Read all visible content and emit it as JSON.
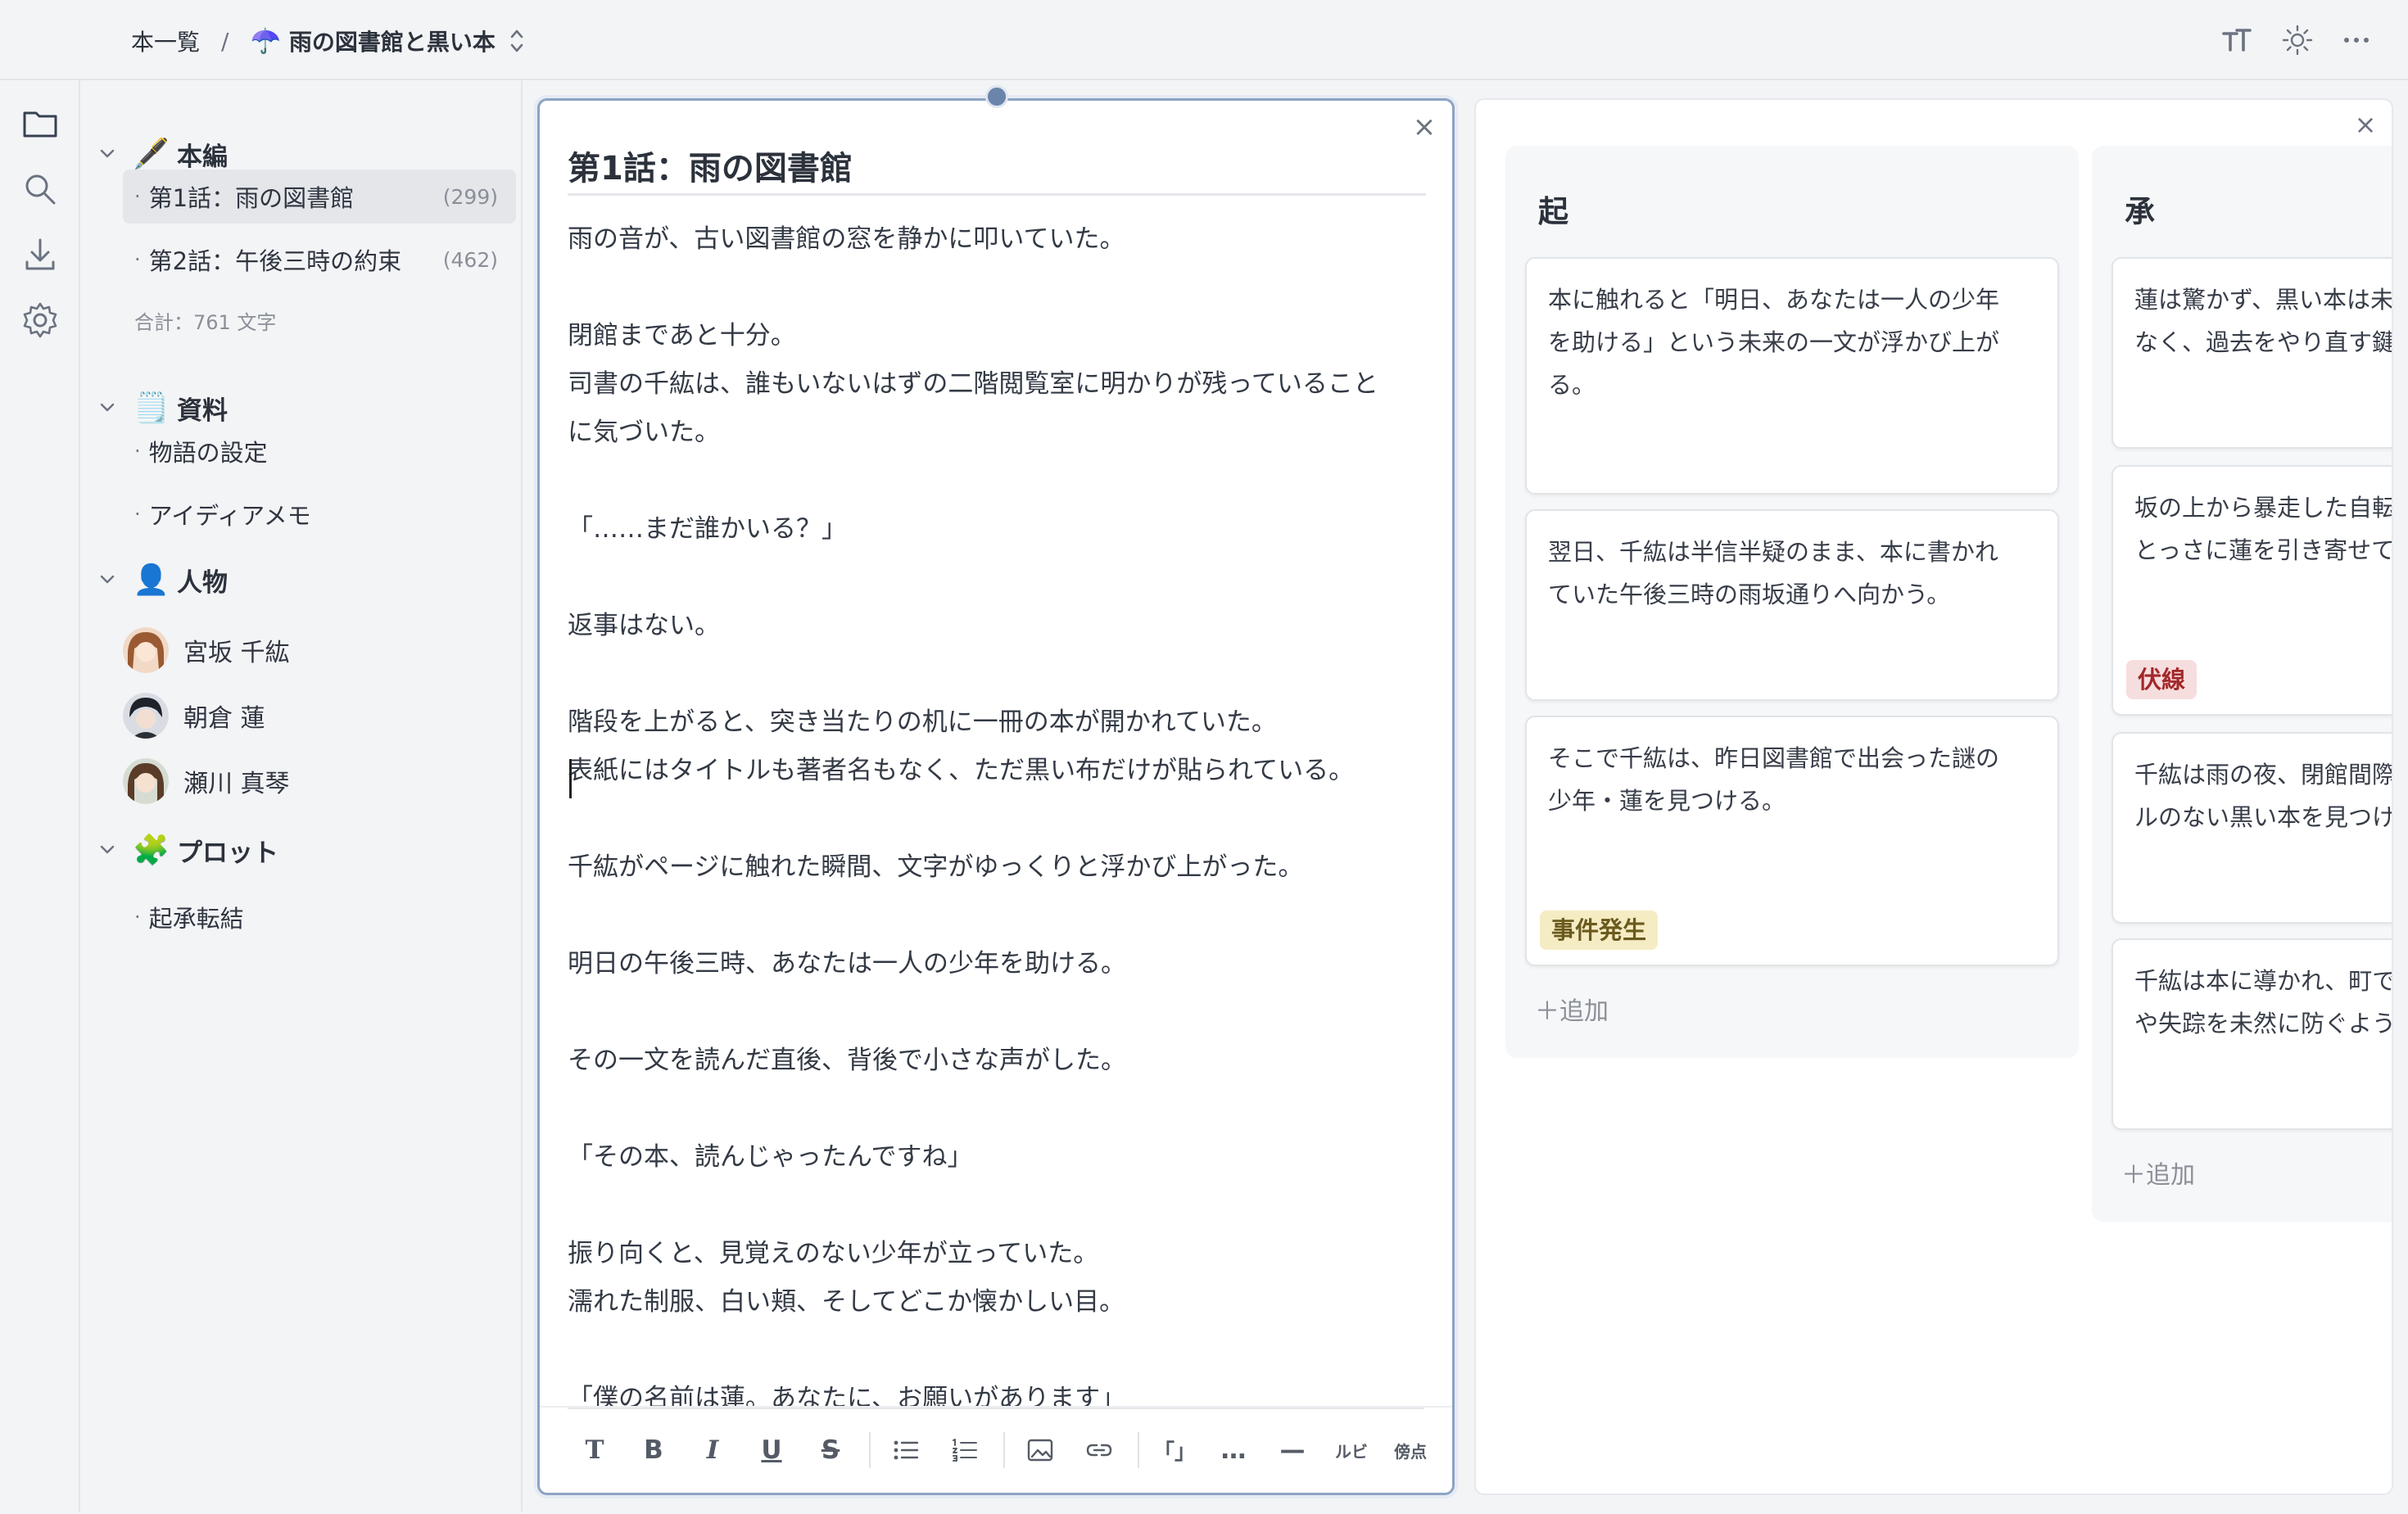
{
  "breadcrumb": {
    "root": "本一覧",
    "separator": "/",
    "book_emoji": "☂️",
    "book_title": "雨の図書館と黒い本"
  },
  "sidebar": {
    "sections": [
      {
        "emoji": "🖋️",
        "label": "本編"
      },
      {
        "emoji": "🗒️",
        "label": "資料"
      },
      {
        "emoji": "👤",
        "label": "人物"
      },
      {
        "emoji": "🧩",
        "label": "プロット"
      }
    ],
    "chapters": [
      {
        "label": "第1話：雨の図書館",
        "count": "(299)"
      },
      {
        "label": "第2話：午後三時の約束",
        "count": "(462)"
      }
    ],
    "total": "合計：761 文字",
    "materials": [
      "物語の設定",
      "アイディアメモ"
    ],
    "characters": [
      "宮坂 千紘",
      "朝倉 蓮",
      "瀬川 真琴"
    ],
    "plots": [
      "起承転結"
    ]
  },
  "editor": {
    "title": "第1話：雨の図書館",
    "body": "雨の音が、古い図書館の窓を静かに叩いていた。\n\n閉館まであと十分。\n司書の千紘は、誰もいないはずの二階閲覧室に明かりが残っていること\nに気づいた。\n\n「……まだ誰かいる？」\n\n返事はない。\n\n階段を上がると、突き当たりの机に一冊の本が開かれていた。\n表紙にはタイトルも著者名もなく、ただ黒い布だけが貼られている。\n\n千紘がページに触れた瞬間、文字がゆっくりと浮かび上がった。\n\n明日の午後三時、あなたは一人の少年を助ける。\n\nその一文を読んだ直後、背後で小さな声がした。\n\n「その本、読んじゃったんですね」\n\n振り向くと、見覚えのない少年が立っていた。\n濡れた制服、白い頬、そしてどこか懐かしい目。\n\n「僕の名前は蓮。あなたに、お願いがあります」",
    "toolbar": [
      "T",
      "B",
      "I",
      "U",
      "S",
      "bulleted-list",
      "numbered-list",
      "image",
      "link",
      "「」",
      "…",
      "—",
      "ルビ",
      "傍点"
    ]
  },
  "board": {
    "columns": [
      {
        "title": "起",
        "cards": [
          {
            "text": "本に触れると「明日、あなたは一人の少年\nを助ける」という未来の一文が浮かび上が\nる。"
          },
          {
            "text": "翌日、千紘は半信半疑のまま、本に書かれ\nていた午後三時の雨坂通りへ向かう。"
          },
          {
            "text": "そこで千紘は、昨日図書館で出会った謎の\n少年・蓮を見つける。",
            "tag": "事件発生"
          }
        ],
        "add_label": "＋追加"
      },
      {
        "title": "承",
        "cards": [
          {
            "text": "蓮は驚かず、黒い本は未\nなく、過去をやり直す鍵"
          },
          {
            "text": "坂の上から暴走した自転\nとっさに蓮を引き寄せて",
            "tag": "伏線"
          },
          {
            "text": "千紘は雨の夜、閉館間際\nルのない黒い本を見つけ"
          },
          {
            "text": "千紘は本に導かれ、町で\nや失踪を未然に防ぐよう"
          }
        ],
        "add_label": "＋追加"
      }
    ]
  },
  "colors": {
    "accent": "#6a84ab",
    "tag_event_bg": "#f5ecc4",
    "tag_event_fg": "#6b5a1e",
    "tag_foreshadow_bg": "#f6dede",
    "tag_foreshadow_fg": "#a3282b"
  }
}
